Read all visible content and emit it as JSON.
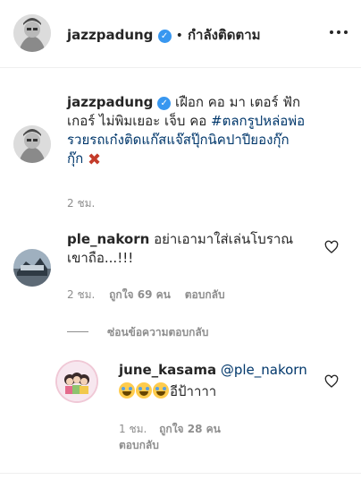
{
  "header": {
    "username": "jazzpadung",
    "separator": "•",
    "following_label": "กำลังติดตาม",
    "more_icon": "more-dots-icon"
  },
  "caption": {
    "username": "jazzpadung",
    "text_line1": "เฝือก คอ มา เตอร์ ฟัก",
    "text_line2_plain": "เกอร์ ไม่พิมเยอะ เจ็บ คอ ",
    "hashtag_part1": "#ตลกรูปหล่อพ่อ",
    "hashtag_part2": "รวยรถเก๋งติดแก๊สแจ๊สปุ๊กนิคปาปียองกุ๊ก",
    "hashtag_part3": "กุ๊ก",
    "emoji": "✖",
    "time": "2 ชม."
  },
  "comments": [
    {
      "username": "ple_nakorn",
      "text_line1": "อย่าเอามาใส่เล่นโบราณ",
      "text_line2": "เขาถือ...!!!",
      "time": "2 ชม.",
      "likes": "ถูกใจ 69 คน",
      "reply_label": "ตอบกลับ",
      "hide_replies_label": "ซ่อนข้อความตอบกลับ"
    }
  ],
  "reply": {
    "username": "june_kasama",
    "mention": "@ple_nakorn",
    "text": "อีป้าาาา",
    "time": "1 ชม.",
    "likes": "ถูกใจ 28 คน",
    "reply_label": "ตอบกลับ"
  }
}
